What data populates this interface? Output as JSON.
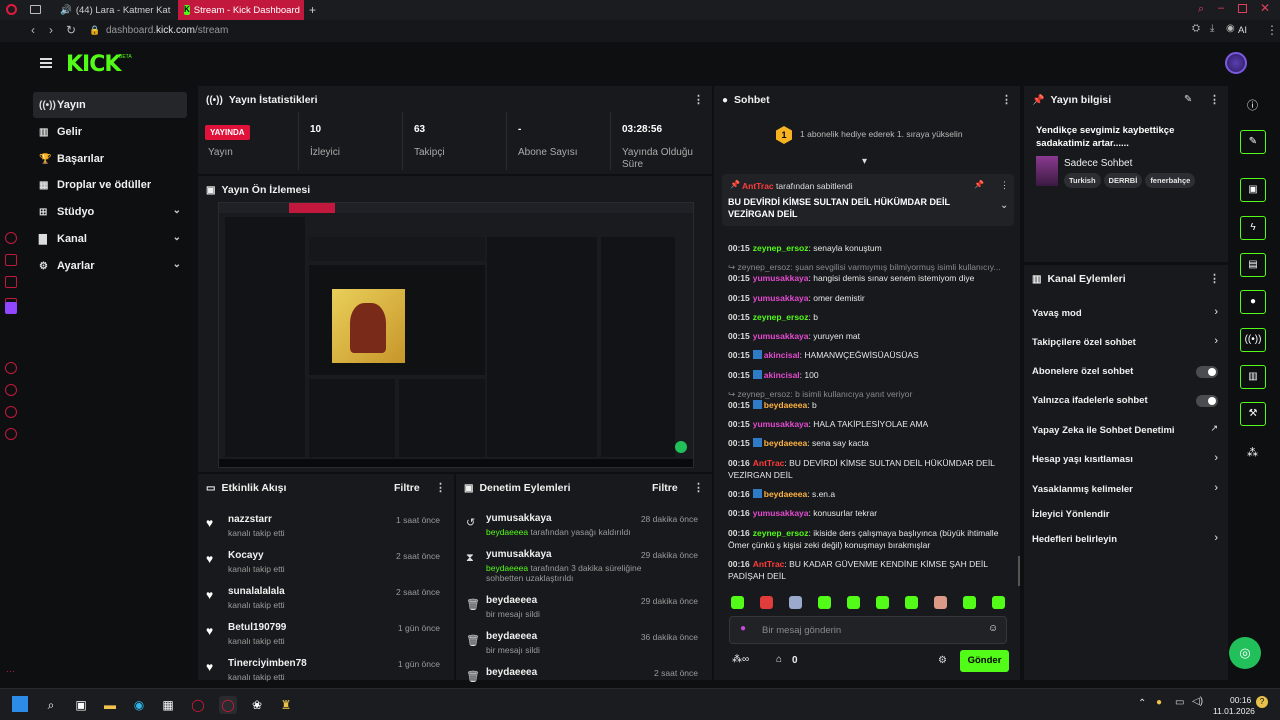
{
  "browser": {
    "tabs": [
      {
        "label": "(44) Lara - Katmer Kat"
      },
      {
        "label": "Stream - Kick Dashboard"
      }
    ],
    "url_prefix": "dashboard.",
    "url_domain": "kick.com",
    "url_path": "/stream",
    "ai_label": "AI"
  },
  "brand": {
    "logo": "KICK",
    "beta": "BETA",
    "accent": "#53fc18"
  },
  "nav": {
    "items": [
      {
        "label": "Yayın",
        "icon": "broadcast-icon"
      },
      {
        "label": "Gelir",
        "icon": "chart-icon"
      },
      {
        "label": "Başarılar",
        "icon": "trophy-icon"
      },
      {
        "label": "Droplar ve ödüller",
        "icon": "gift-icon"
      },
      {
        "label": "Stüdyo",
        "icon": "layout-icon"
      },
      {
        "label": "Kanal",
        "icon": "person-icon"
      },
      {
        "label": "Ayarlar",
        "icon": "gear-icon"
      }
    ]
  },
  "stats": {
    "title": "Yayın İstatistikleri",
    "live_badge": "YAYINDA",
    "live_label": "Yayın",
    "items": [
      {
        "value": "10",
        "label": "İzleyici"
      },
      {
        "value": "63",
        "label": "Takipçi"
      },
      {
        "value": "-",
        "label": "Abone Sayısı"
      },
      {
        "value": "03:28:56",
        "label": "Yayında Olduğu Süre"
      }
    ]
  },
  "preview": {
    "title": "Yayın Ön İzlemesi"
  },
  "activity": {
    "title": "Etkinlik Akışı",
    "filter": "Filtre",
    "items": [
      {
        "name": "nazzstarr",
        "sub": "kanalı takip etti",
        "time": "1 saat önce"
      },
      {
        "name": "Kocayy",
        "sub": "kanalı takip etti",
        "time": "2 saat önce"
      },
      {
        "name": "sunalalalala",
        "sub": "kanalı takip etti",
        "time": "2 saat önce"
      },
      {
        "name": "Betul190799",
        "sub": "kanalı takip etti",
        "time": "1 gün önce"
      },
      {
        "name": "Tinerciyimben78",
        "sub": "kanalı takip etti",
        "time": "1 gün önce"
      }
    ]
  },
  "moderation": {
    "title": "Denetim Eylemleri",
    "filter": "Filtre",
    "items": [
      {
        "name": "yumusakkaya",
        "actor": "beydaeeea",
        "sub": "tarafından yasağı kaldırıldı",
        "time": "28 dakika önce"
      },
      {
        "name": "yumusakkaya",
        "actor": "beydaeeea",
        "sub": "tarafından 3 dakika süreliğine sohbetten uzaklaştırıldı",
        "time": "29 dakika önce"
      },
      {
        "name": "beydaeeea",
        "actor": "",
        "sub": "bir mesajı sildi",
        "time": "29 dakika önce"
      },
      {
        "name": "beydaeeea",
        "actor": "",
        "sub": "bir mesajı sildi",
        "time": "36 dakika önce"
      },
      {
        "name": "beydaeeea",
        "actor": "",
        "sub": "",
        "time": "2 saat önce"
      }
    ]
  },
  "chat": {
    "title": "Sohbet",
    "gift_banner": "1 abonelik hediye ederek 1. sıraya yükselin",
    "gift_count": "1",
    "pinned_by": "AntTrac",
    "pinned_suffix": "tarafından sabitlendi",
    "pinned_text": "BU DEVİRDİ KİMSE SULTAN DEİL HÜKÜMDAR DEİL VEZİRGAN DEİL",
    "messages": [
      {
        "time": "00:15",
        "user": "zeynep_ersoz",
        "color": "green",
        "text": "senayla konuştum"
      },
      {
        "time": "",
        "user": "",
        "color": "sys",
        "text": "↪ zeynep_ersoz: şuan sevgilisi varmıymış bilmiyormuş isimli kullanıcıy..."
      },
      {
        "time": "00:15",
        "user": "yumusakkaya",
        "color": "pink",
        "text": "hangisi demis sınav senem istemiyom diye"
      },
      {
        "time": "00:15",
        "user": "yumusakkaya",
        "color": "pink",
        "text": "omer demistir"
      },
      {
        "time": "00:15",
        "user": "zeynep_ersoz",
        "color": "green",
        "text": "b"
      },
      {
        "time": "00:15",
        "user": "yumusakkaya",
        "color": "pink",
        "text": "yuruyen mat"
      },
      {
        "time": "00:15",
        "user": "akincisal",
        "color": "pink",
        "text": "HAMANWÇEĞWİSÜAÜSÜAS"
      },
      {
        "time": "00:15",
        "user": "akincisal",
        "color": "pink",
        "text": "100"
      },
      {
        "time": "",
        "user": "",
        "color": "sys",
        "text": "↪ zeynep_ersoz: b isimli kullanıcıya yanıt veriyor"
      },
      {
        "time": "00:15",
        "user": "beydaeeea",
        "color": "orange",
        "text": "b"
      },
      {
        "time": "00:15",
        "user": "yumusakkaya",
        "color": "pink",
        "text": "HALA TAKİPLESİYOLAE AMA"
      },
      {
        "time": "00:15",
        "user": "beydaeeea",
        "color": "orange",
        "text": "sena say kacta"
      },
      {
        "time": "00:16",
        "user": "AntTrac",
        "color": "red",
        "text": "BU DEVİRDİ KİMSE SULTAN DEİL HÜKÜMDAR DEİL VEZİRGAN DEİL"
      },
      {
        "time": "00:16",
        "user": "beydaeeea",
        "color": "orange",
        "text": "s.en.a"
      },
      {
        "time": "00:16",
        "user": "yumusakkaya",
        "color": "pink",
        "text": "konusurlar tekrar"
      },
      {
        "time": "00:16",
        "user": "zeynep_ersoz",
        "color": "green",
        "text": "ikiside ders çalışmaya başlıyınca (büyük ihtimalle Ömer çünkü ş kişisi zeki değil) konuşmayı bırakmışlar"
      },
      {
        "time": "00:16",
        "user": "AntTrac",
        "color": "red",
        "text": "BU KADAR GÜVENME KENDİNE KİMSE ŞAH DEİL PADİŞAH DEİL"
      }
    ],
    "input_placeholder": "Bir mesaj gönderin",
    "send_label": "Gönder",
    "viewer_count": "0"
  },
  "stream_info": {
    "title": "Yayın bilgisi",
    "stream_title": "Yendikçe sevgimiz kaybettikçe sadakatimiz artar......",
    "category": "Sadece Sohbet",
    "tags": [
      "Turkish",
      "DERRBİ",
      "fenerbahçe"
    ]
  },
  "channel_actions": {
    "title": "Kanal Eylemleri",
    "items": [
      {
        "label": "Yavaş mod",
        "control": "chevron"
      },
      {
        "label": "Takipçilere özel sohbet",
        "control": "chevron"
      },
      {
        "label": "Abonelere özel sohbet",
        "control": "toggle"
      },
      {
        "label": "Yalnızca ifadelerle sohbet",
        "control": "toggle"
      },
      {
        "label": "Yapay Zeka ile Sohbet Denetimi",
        "control": "external"
      },
      {
        "label": "Hesap yaşı kısıtlaması",
        "control": "chevron"
      },
      {
        "label": "Yasaklanmış kelimeler",
        "control": "chevron"
      },
      {
        "label": "İzleyici Yönlendir",
        "control": "none"
      },
      {
        "label": "Hedefleri belirleyin",
        "control": "chevron"
      }
    ]
  },
  "taskbar": {
    "time": "00:16",
    "date": "11.01.2026"
  }
}
